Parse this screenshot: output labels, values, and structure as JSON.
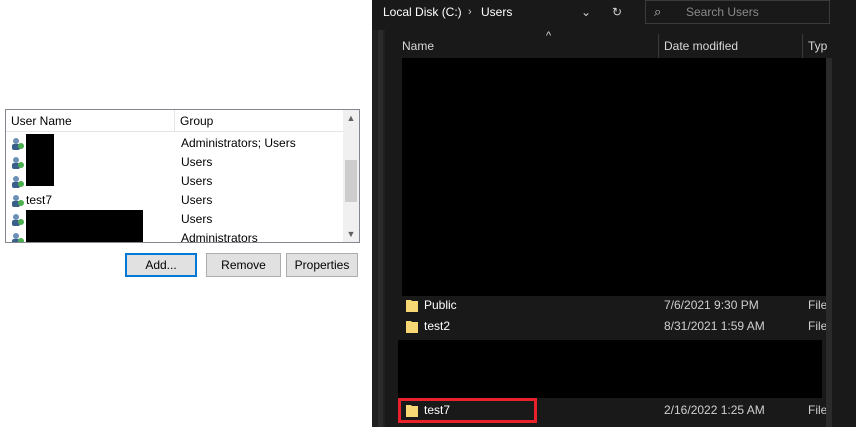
{
  "users_dialog": {
    "columns": {
      "user_name": "User Name",
      "group": "Group"
    },
    "rows": [
      {
        "name": "",
        "group": "Administrators; Users",
        "redacted": true
      },
      {
        "name": "",
        "group": "Users",
        "redacted": true
      },
      {
        "name": "",
        "group": "Users",
        "redacted": true
      },
      {
        "name": "test7",
        "group": "Users",
        "redacted": false
      },
      {
        "name": "",
        "group": "Users",
        "redacted": true
      },
      {
        "name": "",
        "group": "Administrators",
        "redacted": true
      }
    ],
    "buttons": {
      "add": "Add...",
      "remove": "Remove",
      "properties": "Properties"
    }
  },
  "explorer": {
    "breadcrumb": [
      "Local Disk (C:)",
      "Users"
    ],
    "breadcrumb_separator": "›",
    "search_placeholder": "Search Users",
    "columns": {
      "name": "Name",
      "date_modified": "Date modified",
      "type": "Typ"
    },
    "items": [
      {
        "name": "Public",
        "date": "7/6/2021 9:30 PM",
        "type": "File"
      },
      {
        "name": "test2",
        "date": "8/31/2021 1:59 AM",
        "type": "File"
      },
      {
        "name": "test7",
        "date": "2/16/2022 1:25 AM",
        "type": "File",
        "highlighted": true
      }
    ],
    "icons": {
      "search": "search-icon",
      "refresh": "refresh-icon",
      "dropdown": "chevron-down-icon",
      "folder": "folder-icon"
    },
    "colors": {
      "folder": "#f7d774",
      "highlight": "#e8212b",
      "background": "#191919"
    }
  }
}
